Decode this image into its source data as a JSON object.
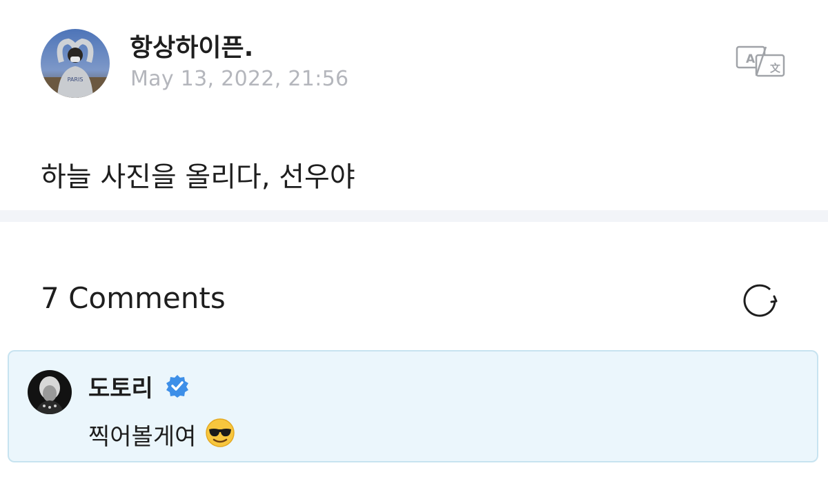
{
  "post": {
    "author_name": "항상하이픈.",
    "timestamp": "May 13, 2022, 21:56",
    "body": "하늘 사진을 올리다, 선우야"
  },
  "comments_section": {
    "title": "7 Comments"
  },
  "comment": {
    "author_name": "도토리",
    "verified": true,
    "text": "찍어볼게여",
    "emoji": "smiling-face-with-sunglasses"
  },
  "colors": {
    "text_primary": "#1e1e1e",
    "text_muted": "#b4b6bc",
    "comment_bg": "#ebf6fc",
    "comment_border": "#c7e3f0",
    "verified_blue": "#3d8fe8",
    "divider": "#f2f4f8"
  },
  "icons": {
    "translate": "translate-icon",
    "refresh": "refresh-icon",
    "verified": "verified-badge-icon"
  }
}
